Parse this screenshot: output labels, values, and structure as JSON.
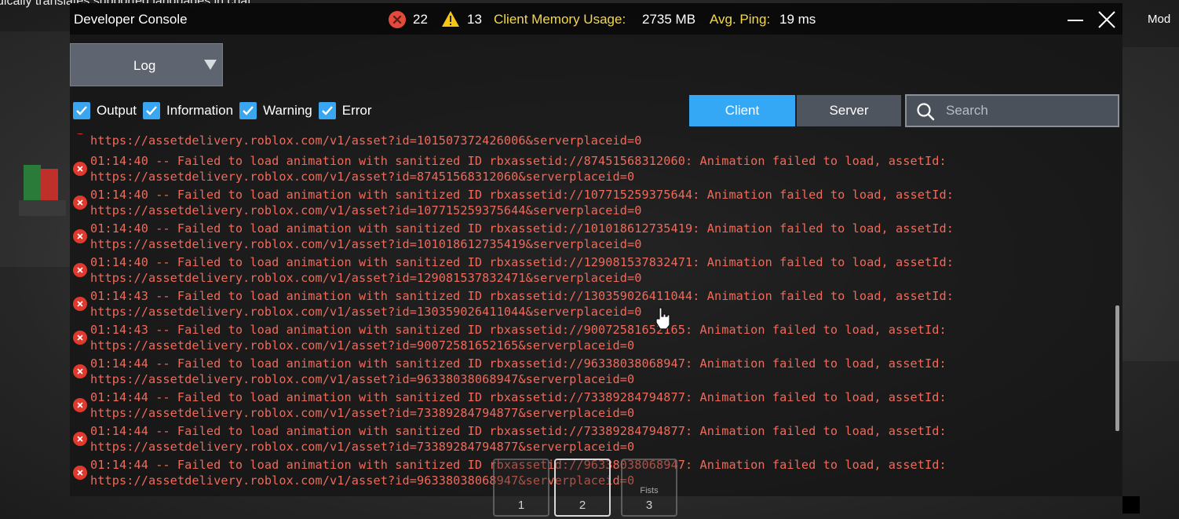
{
  "background": {
    "hint_text": "dically translates supported languages in chat",
    "right_text": "Mod"
  },
  "console": {
    "title": "Developer Console",
    "error_count": "22",
    "warning_count": "13",
    "memory_label": "Client Memory Usage:",
    "memory_value": "2735 MB",
    "ping_label": "Avg. Ping:",
    "ping_value": "19 ms",
    "minimize_icon": "minimize-icon",
    "close_icon": "close-icon",
    "log_dropdown_value": "Log",
    "filters": [
      {
        "label": "Output",
        "checked": true
      },
      {
        "label": "Information",
        "checked": true
      },
      {
        "label": "Warning",
        "checked": true
      },
      {
        "label": "Error",
        "checked": true
      }
    ],
    "client_label": "Client",
    "server_label": "Server",
    "search_placeholder": "Search",
    "colors": {
      "accent": "#35a8f5",
      "error": "#e0392d",
      "log_text": "#ef6a5a",
      "stat_label": "#f5d84a"
    }
  },
  "logs": {
    "partial_first_line": "https://assetdelivery.roblox.com/v1/asset?id=101507372426006&serverplaceid=0",
    "entries": [
      {
        "line1": "01:14:40 -- Failed to load animation with sanitized ID rbxassetid://87451568312060: Animation failed to load, assetId:",
        "line2": "https://assetdelivery.roblox.com/v1/asset?id=87451568312060&serverplaceid=0"
      },
      {
        "line1": "01:14:40 -- Failed to load animation with sanitized ID rbxassetid://107715259375644: Animation failed to load, assetId:",
        "line2": "https://assetdelivery.roblox.com/v1/asset?id=107715259375644&serverplaceid=0"
      },
      {
        "line1": "01:14:40 -- Failed to load animation with sanitized ID rbxassetid://101018612735419: Animation failed to load, assetId:",
        "line2": "https://assetdelivery.roblox.com/v1/asset?id=101018612735419&serverplaceid=0"
      },
      {
        "line1": "01:14:40 -- Failed to load animation with sanitized ID rbxassetid://129081537832471: Animation failed to load, assetId:",
        "line2": "https://assetdelivery.roblox.com/v1/asset?id=129081537832471&serverplaceid=0"
      },
      {
        "line1": "01:14:43 -- Failed to load animation with sanitized ID rbxassetid://130359026411044: Animation failed to load, assetId:",
        "line2": "https://assetdelivery.roblox.com/v1/asset?id=130359026411044&serverplaceid=0"
      },
      {
        "line1": "01:14:43 -- Failed to load animation with sanitized ID rbxassetid://90072581652165: Animation failed to load, assetId:",
        "line2": "https://assetdelivery.roblox.com/v1/asset?id=90072581652165&serverplaceid=0"
      },
      {
        "line1": "01:14:44 -- Failed to load animation with sanitized ID rbxassetid://96338038068947: Animation failed to load, assetId:",
        "line2": "https://assetdelivery.roblox.com/v1/asset?id=96338038068947&serverplaceid=0"
      },
      {
        "line1": "01:14:44 -- Failed to load animation with sanitized ID rbxassetid://73389284794877: Animation failed to load, assetId:",
        "line2": "https://assetdelivery.roblox.com/v1/asset?id=73389284794877&serverplaceid=0"
      },
      {
        "line1": "01:14:44 -- Failed to load animation with sanitized ID rbxassetid://73389284794877: Animation failed to load, assetId:",
        "line2": "https://assetdelivery.roblox.com/v1/asset?id=73389284794877&serverplaceid=0"
      },
      {
        "line1": "01:14:44 -- Failed to load animation with sanitized ID rbxassetid://96338038068947: Animation failed to load, assetId:",
        "line2": "https://assetdelivery.roblox.com/v1/asset?id=96338038068947&serverplaceid=0"
      }
    ]
  },
  "hotbar": [
    {
      "number": "1",
      "name": ""
    },
    {
      "number": "2",
      "name": ""
    },
    {
      "number": "3",
      "name": "Fists"
    }
  ]
}
